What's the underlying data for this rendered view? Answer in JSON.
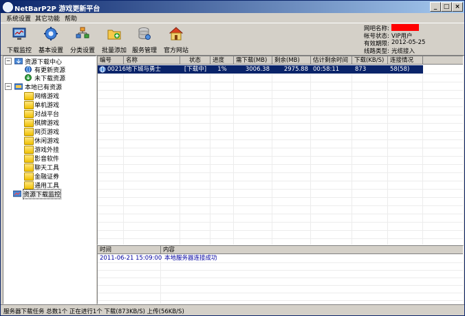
{
  "window": {
    "title": "NetBarP2P 游戏更新平台",
    "controls": {
      "minimize": "_",
      "maximize": "□",
      "close": "×"
    }
  },
  "menu": [
    "系统设置",
    "其它功能",
    "帮助"
  ],
  "toolbar": [
    {
      "label": "下载监控",
      "icon": "monitor-icon"
    },
    {
      "label": "基本设置",
      "icon": "gear-icon"
    },
    {
      "label": "分类设置",
      "icon": "category-icon"
    },
    {
      "label": "批量添加",
      "icon": "batch-add-icon"
    },
    {
      "label": "服务管理",
      "icon": "server-icon"
    },
    {
      "label": "官方网站",
      "icon": "home-icon"
    }
  ],
  "account": {
    "netbar_name_label": "网吧名称:",
    "status_label": "帐号状态:",
    "status": "VIP用户",
    "expiry_label": "有效期限:",
    "expiry": "2012-05-25",
    "line_label": "线路类型:",
    "line": "光缆接入"
  },
  "tree": {
    "resource_center": "资源下载中心",
    "updated": "有更新资源",
    "not_downloaded": "未下载资源",
    "local": "本地已有资源",
    "categories": [
      "网络游戏",
      "单机游戏",
      "对战平台",
      "棋牌游戏",
      "网页游戏",
      "休闲游戏",
      "游戏外挂",
      "影音软件",
      "聊天工具",
      "金融证券",
      "通用工具"
    ],
    "monitor": "资源下载监控"
  },
  "grid": {
    "headers": [
      "编号",
      "名称",
      "状态",
      "进度",
      "需下载(MB)",
      "剩余(MB)",
      "估计剩余时间",
      "下载(KB/S)",
      "连接情况"
    ],
    "rows": [
      {
        "id": "00216",
        "name": "地下城与勇士",
        "status": "[下载中]",
        "progress": "1%",
        "need": "3006.38",
        "remaining": "2975.88",
        "eta": "00:58:11",
        "speed": "873",
        "connections": "58(58)"
      }
    ]
  },
  "log": {
    "headers": [
      "时间",
      "内容"
    ],
    "rows": [
      {
        "time": "2011-06-21 15:09:00",
        "content": "本地服务器连接成功"
      }
    ]
  },
  "status": {
    "text": "服务器下载任务 总数1个 正在进行1个 下载(873KB/S) 上传(56KB/S)"
  },
  "colors": {
    "title_start": "#0a246a",
    "title_end": "#a6caf0",
    "selection": "#0a246a",
    "face": "#d4d0c8",
    "log_text": "#0000a0",
    "redaction": "#ff0000"
  }
}
